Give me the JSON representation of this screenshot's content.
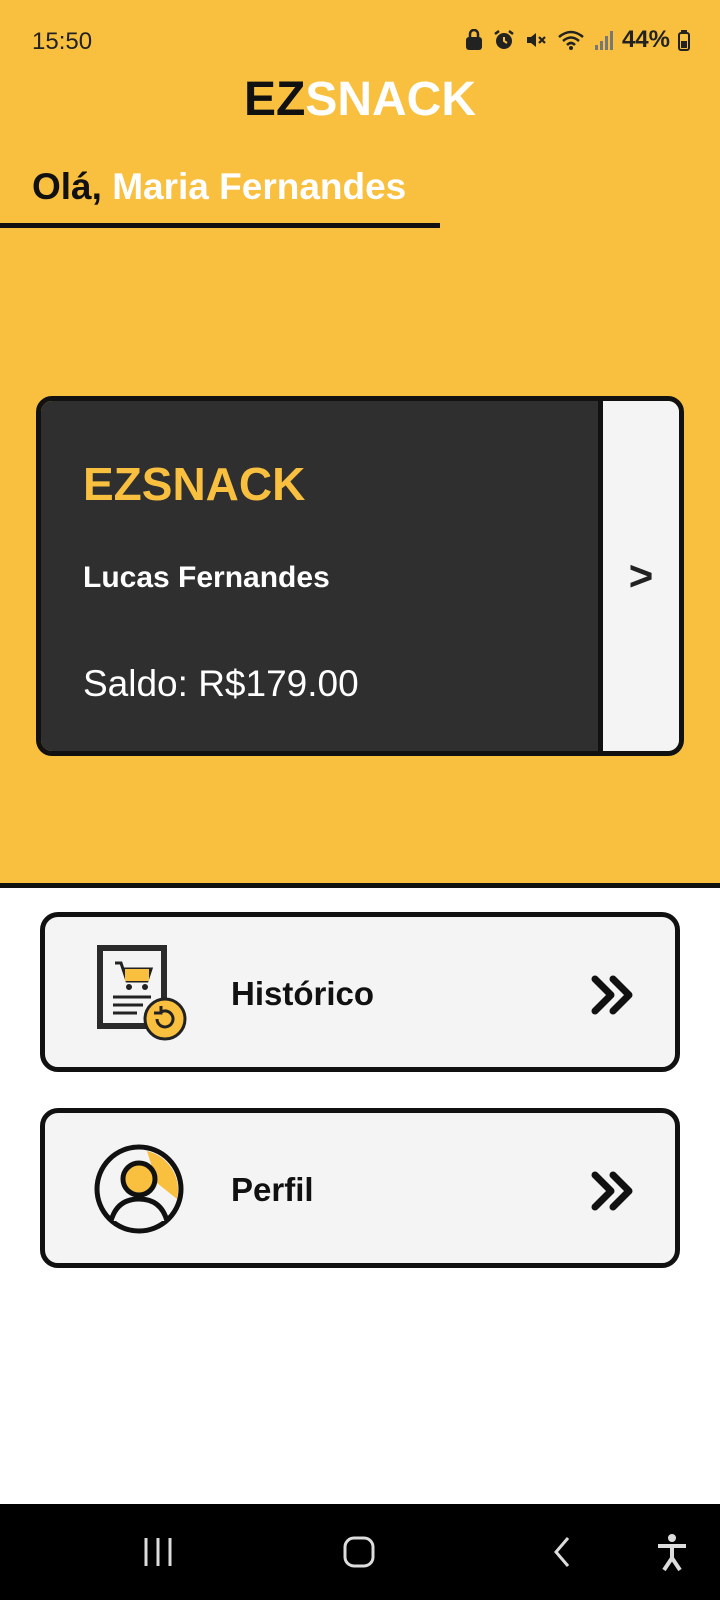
{
  "status_bar": {
    "time": "15:50",
    "battery_percent": "44%",
    "icons": [
      "lock-icon",
      "alarm-icon",
      "mute-icon",
      "wifi-icon",
      "signal-icon",
      "battery-icon"
    ]
  },
  "app": {
    "brand_part1": "EZ",
    "brand_part2": "SNACK"
  },
  "greeting": {
    "hello": "Olá,",
    "user_name": "Maria Fernandes"
  },
  "card": {
    "brand": "EZSNACK",
    "holder": "Lucas Fernandes",
    "balance": "Saldo: R$179.00",
    "arrow": ">"
  },
  "menu": [
    {
      "label": "Histórico",
      "icon": "history-cart-icon"
    },
    {
      "label": "Perfil",
      "icon": "profile-icon"
    }
  ],
  "nav_bar": {
    "buttons": [
      "recent-apps-icon",
      "home-icon",
      "back-icon",
      "accessibility-icon"
    ]
  },
  "colors": {
    "accent": "#F9C03F",
    "card_dark": "#2f2f2f",
    "outline": "#111111",
    "light": "#f4f4f4"
  }
}
